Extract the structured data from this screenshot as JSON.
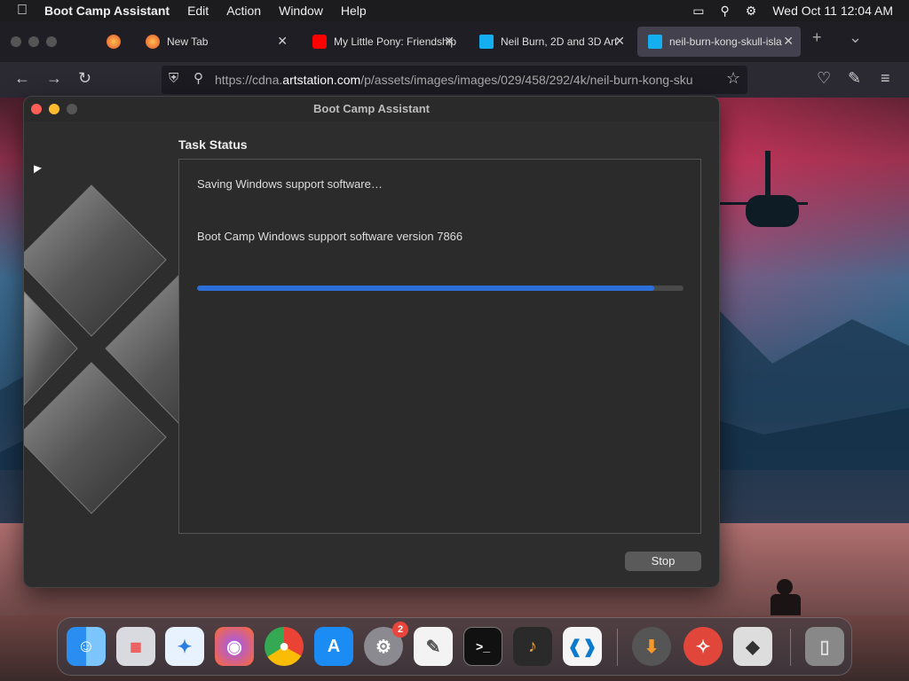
{
  "menubar": {
    "app_name": "Boot Camp Assistant",
    "menus": [
      "Edit",
      "Action",
      "Window",
      "Help"
    ],
    "datetime": "Wed Oct 11  12:04 AM"
  },
  "browser": {
    "tabs": [
      {
        "title": "New Tab"
      },
      {
        "title": "My Little Pony: Friendship"
      },
      {
        "title": "Neil Burn, 2D and 3D Art"
      },
      {
        "title": "neil-burn-kong-skull-isla"
      }
    ],
    "url_prefix": "https://cdna.",
    "url_domain": "artstation.com",
    "url_rest": "/p/assets/images/images/029/458/292/4k/neil-burn-kong-sku"
  },
  "bootcamp": {
    "window_title": "Boot Camp Assistant",
    "section_title": "Task Status",
    "status_line1": "Saving Windows support software…",
    "status_line2": "Boot Camp Windows support software version 7866",
    "progress": 0.94,
    "stop_label": "Stop"
  },
  "dock": {
    "settings_badge": "2"
  }
}
